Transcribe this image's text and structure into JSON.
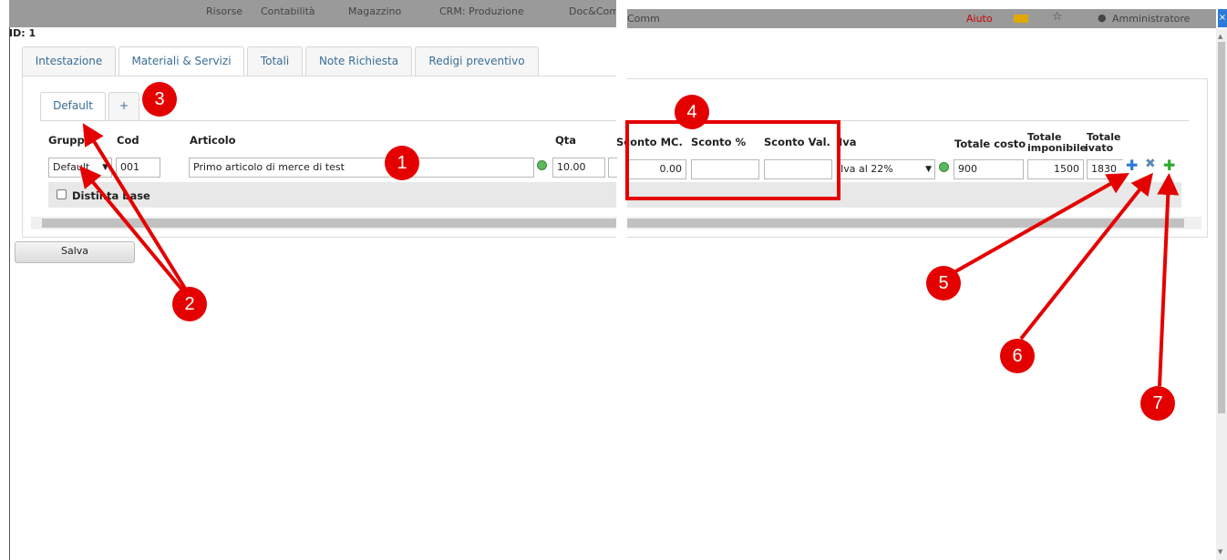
{
  "modal_title": "ID: 1",
  "topbar_left": [
    "Risorse",
    "Contabilità",
    "Magazzino",
    "CRM: Produzione",
    "Doc&Com"
  ],
  "topbar_right": [
    "Comm",
    "Aiuto",
    "Amministratore"
  ],
  "tabs": [
    "Intestazione",
    "Materiali & Servizi",
    "Totali",
    "Note Richiesta",
    "Redigi preventivo"
  ],
  "group_tabs": [
    "Default",
    "+"
  ],
  "columns": {
    "gruppo": "Gruppo",
    "cod": "Cod",
    "articolo": "Articolo",
    "qta": "Qta",
    "sconto_mc": "Sconto MC.",
    "sconto_pct": "Sconto %",
    "sconto_val": "Sconto Val.",
    "iva": "Iva",
    "totale_costo": "Totale costo",
    "totale_imponibile": [
      "Totale",
      "imponibile"
    ],
    "totale_ivato": [
      "Totale",
      "ivato"
    ]
  },
  "row": {
    "gruppo": "Default",
    "cod": "001",
    "articolo": "Primo articolo di merce di test",
    "qta": "10.00",
    "sconto_mc": "0.00",
    "sconto_pct": "",
    "sconto_val": "",
    "iva": "Iva al 22%",
    "totale_costo": "900",
    "totale_imponibile": "1500",
    "totale_ivato": "1830"
  },
  "distinta_label": "Distinta base",
  "save_label": "Salva",
  "annotations": [
    "1",
    "2",
    "3",
    "4",
    "5",
    "6",
    "7"
  ],
  "colors": {
    "annotation": "#e50000",
    "tab_text": "#3a6e96",
    "help_link": "#cc0000"
  }
}
